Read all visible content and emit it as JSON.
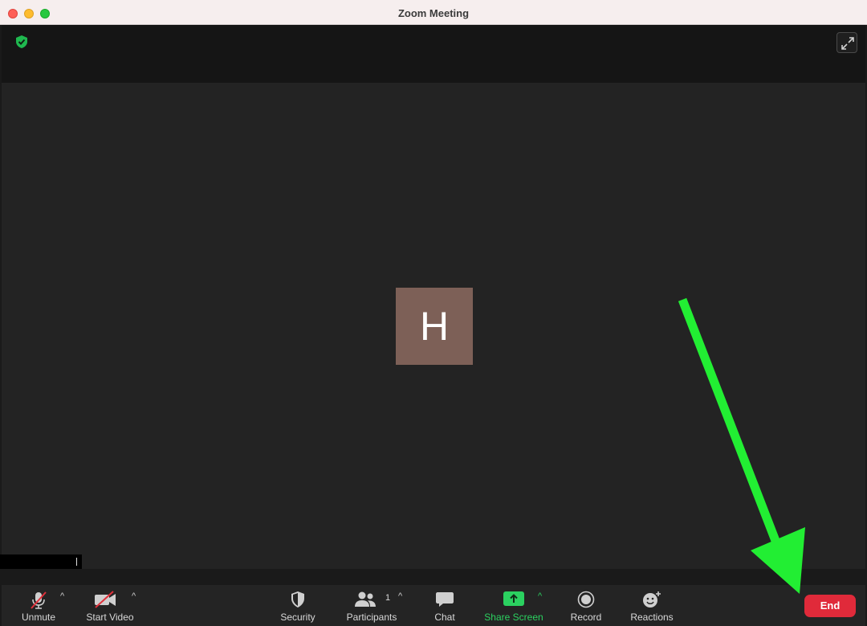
{
  "window": {
    "title": "Zoom Meeting"
  },
  "participant": {
    "initial": "H",
    "avatar_color": "#7d6057"
  },
  "toolbar": {
    "unmute_label": "Unmute",
    "start_video_label": "Start Video",
    "security_label": "Security",
    "participants_label": "Participants",
    "participants_count": "1",
    "chat_label": "Chat",
    "share_screen_label": "Share Screen",
    "record_label": "Record",
    "reactions_label": "Reactions",
    "end_label": "End"
  },
  "colors": {
    "accent_green": "#2bd160",
    "end_red": "#e02a3a",
    "annotation_arrow": "#22ee33"
  },
  "icons": {
    "encryption": "shield-check-icon",
    "fullscreen": "fullscreen-icon",
    "unmute": "microphone-muted-icon",
    "video": "video-off-icon",
    "security": "shield-icon",
    "participants": "people-icon",
    "chat": "chat-bubble-icon",
    "share": "share-screen-icon",
    "record": "record-icon",
    "reactions": "emoji-plus-icon"
  }
}
